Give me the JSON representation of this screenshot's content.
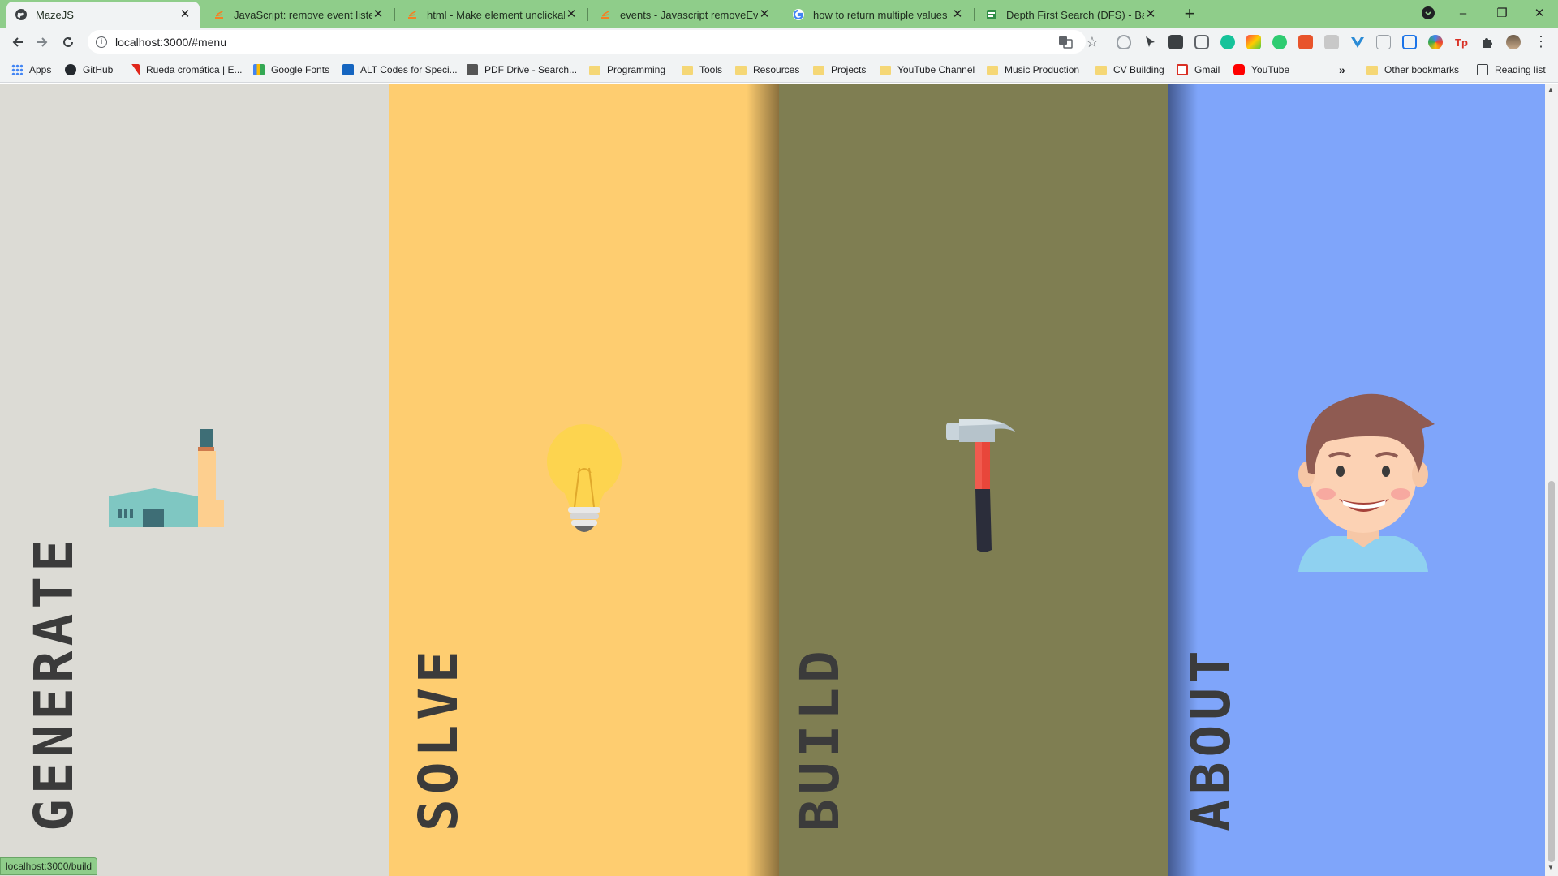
{
  "browser": {
    "tabs": [
      {
        "title": "MazeJS",
        "active": true
      },
      {
        "title": "JavaScript: remove event listener"
      },
      {
        "title": "html - Make element unclickable"
      },
      {
        "title": "events - Javascript removeEventListener"
      },
      {
        "title": "how to return multiple values in"
      },
      {
        "title": "Depth First Search (DFS) - Backtracking"
      }
    ],
    "new_tab": "+",
    "window_controls": {
      "minimize": "–",
      "restore": "❐",
      "close": "✕"
    },
    "url": "localhost:3000/#menu",
    "bookmarks": [
      {
        "label": "Apps",
        "icon": "apps-grid-icon"
      },
      {
        "label": "GitHub",
        "icon": "github-icon"
      },
      {
        "label": "Rueda cromática | E...",
        "icon": "adobe-icon"
      },
      {
        "label": "Google Fonts",
        "icon": "google-fonts-icon"
      },
      {
        "label": "ALT Codes for Speci...",
        "icon": "altcodes-icon"
      },
      {
        "label": "PDF Drive - Search...",
        "icon": "pdfdrive-icon"
      },
      {
        "label": "Programming",
        "icon": "folder-icon"
      },
      {
        "label": "Tools",
        "icon": "folder-icon"
      },
      {
        "label": "Resources",
        "icon": "folder-icon"
      },
      {
        "label": "Projects",
        "icon": "folder-icon"
      },
      {
        "label": "YouTube Channel",
        "icon": "folder-icon"
      },
      {
        "label": "Music Production",
        "icon": "folder-icon"
      },
      {
        "label": "CV Building",
        "icon": "folder-icon"
      },
      {
        "label": "Gmail",
        "icon": "gmail-icon"
      },
      {
        "label": "YouTube",
        "icon": "youtube-icon"
      }
    ],
    "overflow": "»",
    "other_bookmarks": "Other bookmarks",
    "reading_list": "Reading list"
  },
  "menu": {
    "panels": [
      {
        "label": "GENERATE",
        "color": "#dcdbd5",
        "icon": "factory-icon"
      },
      {
        "label": "SOLVE",
        "color": "#fecd70",
        "icon": "lightbulb-icon"
      },
      {
        "label": "BUILD",
        "color": "#7f7e52",
        "icon": "hammer-icon"
      },
      {
        "label": "ABOUT",
        "color": "#7fa5fa",
        "icon": "avatar-icon"
      }
    ]
  },
  "status_bar": {
    "hover_url": "localhost:3000/build"
  }
}
